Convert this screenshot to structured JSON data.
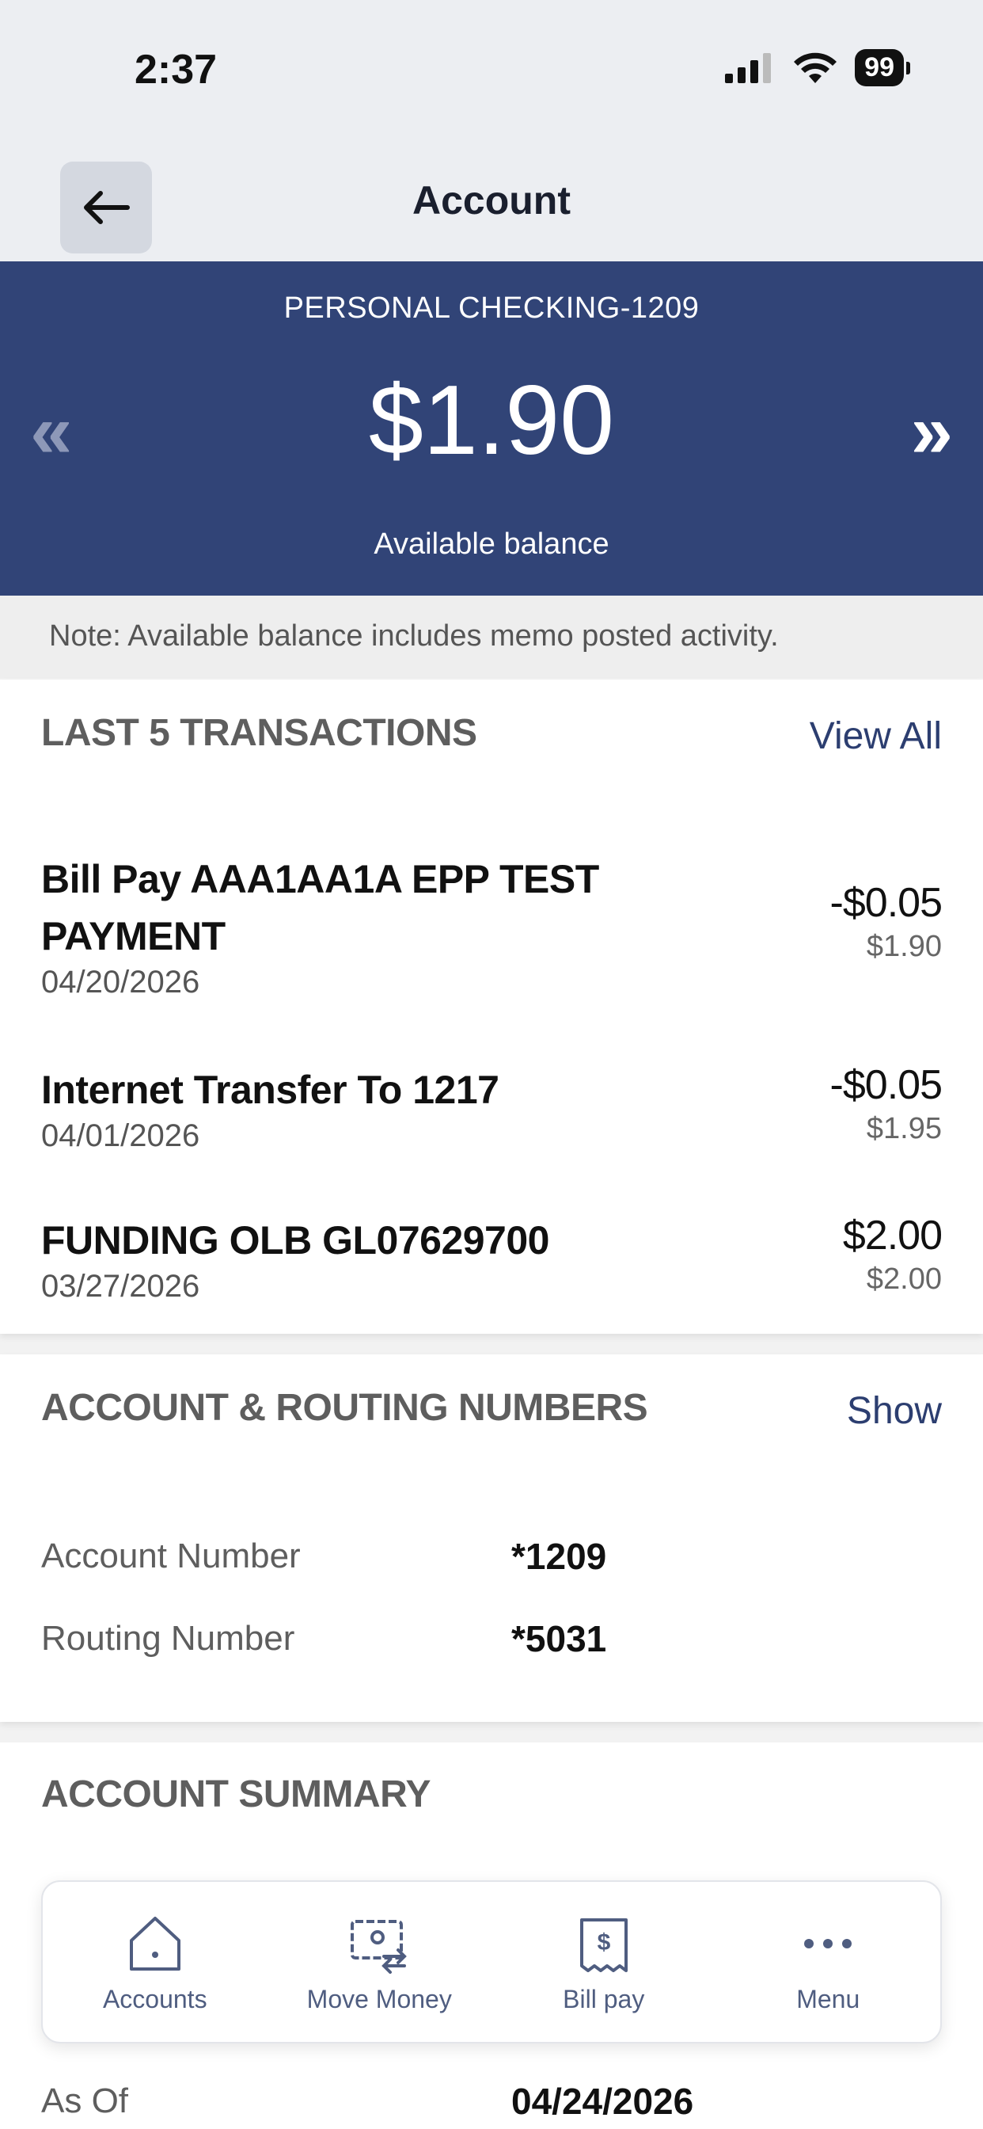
{
  "status_bar": {
    "time": "2:37",
    "battery": "99"
  },
  "header": {
    "title": "Account"
  },
  "banner": {
    "account_name": "PERSONAL CHECKING-1209",
    "balance": "$1.90",
    "balance_label": "Available balance",
    "prev_symbol": "«",
    "next_symbol": "»"
  },
  "note": "Note: Available balance includes memo posted activity.",
  "transactions": {
    "title": "LAST 5 TRANSACTIONS",
    "view_all": "View All",
    "items": [
      {
        "name": "Bill Pay AAA1AA1A EPP TEST PAYMENT",
        "date": "04/20/2026",
        "amount": "-$0.05",
        "balance": "$1.90"
      },
      {
        "name": "Internet Transfer To 1217",
        "date": "04/01/2026",
        "amount": "-$0.05",
        "balance": "$1.95"
      },
      {
        "name": "FUNDING OLB GL07629700",
        "date": "03/27/2026",
        "amount": "$2.00",
        "balance": "$2.00"
      }
    ]
  },
  "routing": {
    "title": "ACCOUNT & ROUTING NUMBERS",
    "show": "Show",
    "account_number_label": "Account Number",
    "account_number": "*1209",
    "routing_number_label": "Routing Number",
    "routing_number": "*5031"
  },
  "summary": {
    "title": "ACCOUNT SUMMARY",
    "as_of_label": "As Of",
    "as_of": "04/24/2026"
  },
  "bottom_nav": {
    "items": [
      {
        "label": "Accounts",
        "icon": "home-icon"
      },
      {
        "label": "Move Money",
        "icon": "money-transfer-icon"
      },
      {
        "label": "Bill pay",
        "icon": "bill-icon"
      },
      {
        "label": "Menu",
        "icon": "more-icon"
      }
    ]
  }
}
